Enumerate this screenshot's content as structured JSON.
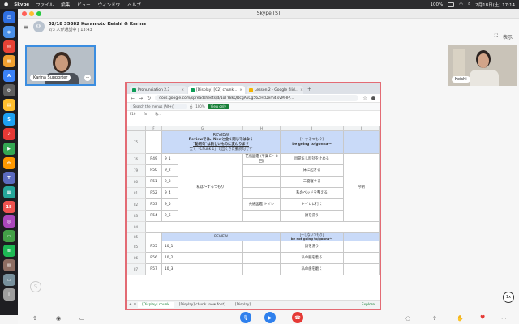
{
  "menubar": {
    "app_name": "Skype",
    "items": [
      "ファイル",
      "編集",
      "ビュー",
      "ウィンドウ",
      "ヘルプ"
    ],
    "battery": "100%",
    "clock": "2月18日(土) 17:14"
  },
  "window": {
    "title": "Skype [S]"
  },
  "call": {
    "group_initials": "KK",
    "title": "02/18 35382 Kuramoto Keishi & Karina",
    "subtitle": "2/3 人が通話中 | 13:43",
    "header_action": "表示"
  },
  "participants": [
    {
      "name": "Karina Supporter"
    },
    {
      "name": "Keishi"
    }
  ],
  "browser": {
    "tabs": [
      {
        "label": "Pronunciation 2.3",
        "color": "#0f9d58"
      },
      {
        "label": "[Display] [C2] chunk...",
        "color": "#0f9d58"
      },
      {
        "label": "Lesson 2 - Google Slid...",
        "color": "#f4b400"
      }
    ],
    "url": "docs.google.com/spreadsheets/d/1oTY8kQDcgAkCg56ZHcDem4IsvMHPj...",
    "menus_placeholder": "Search the menus (Alt+/)",
    "zoom": "100%",
    "view_only": "View only",
    "cell_ref": "F16",
    "formula": "私..."
  },
  "sheet": {
    "columns": [
      "",
      "G",
      "H",
      "I",
      "J"
    ],
    "review_title": "REVIEW",
    "review_line1": "Reviewでは、Newと全く同じではなく",
    "review_line2": "\"動詞句\"は新しいものに変わります",
    "review_line3": "全て「Chunk 1」で出てきた動詞句です",
    "going_header_1": "[～するつもり]",
    "going_header_2": "be going to/gonna～",
    "rows": [
      {
        "num": "76",
        "code": "R49",
        "sub": "9_1",
        "note": "花瓶図鑑 (半翼Ｅ～8回)",
        "phrase": "目覚まし時計を止める"
      },
      {
        "num": "79",
        "code": "R50",
        "sub": "9_2",
        "note": "",
        "phrase": "床に起きる"
      },
      {
        "num": "80",
        "code": "R51",
        "sub": "9_3",
        "note": "",
        "phrase": "二度寝する"
      },
      {
        "num": "81",
        "code": "R52",
        "sub": "9_4",
        "note": "",
        "phrase": "私のベッドを整える"
      },
      {
        "num": "82",
        "code": "R53",
        "sub": "9_5",
        "note": "共通図鑑 トイレ",
        "phrase": "トイレに行く"
      },
      {
        "num": "83",
        "code": "R54",
        "sub": "9_6",
        "note": "",
        "phrase": "顔を洗う"
      }
    ],
    "group_label": "私は～するつもり",
    "time_label": "今朝",
    "review2_title": "REVIEW",
    "notgoing_header_1": "[～しないつもり]",
    "notgoing_header_2": "be not going to/gonna～",
    "rows2": [
      {
        "num": "85",
        "code": "R55",
        "sub": "10_1",
        "phrase": "顔を洗う"
      },
      {
        "num": "86",
        "code": "R56",
        "sub": "10_2",
        "phrase": "私の服を着る"
      },
      {
        "num": "87",
        "code": "R57",
        "sub": "10_3",
        "phrase": "私の歯を磨く"
      }
    ],
    "tabs": [
      "[Display] chunk",
      "[Display] chunk (new font)",
      "[Display] ..."
    ],
    "explore": "Explore"
  },
  "controls": {
    "zoom_badge": "1x"
  }
}
